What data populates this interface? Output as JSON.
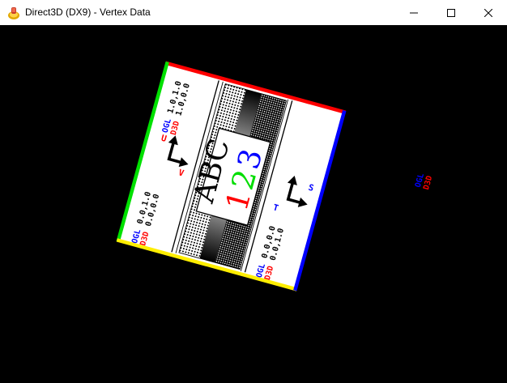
{
  "window": {
    "title": "Direct3D (DX9) - Vertex Data",
    "controls": {
      "minimize_icon": "minimize-icon",
      "maximize_icon": "maximize-icon",
      "close_icon": "close-icon"
    }
  },
  "texture": {
    "center": {
      "letters": "ABC",
      "digit1": "1",
      "digit2": "2",
      "digit3": "3"
    },
    "left_top": {
      "ogl": "OGL",
      "ogl_val": "1.0,1.0",
      "d3d": "D3D",
      "d3d_val": "1.0,0.0"
    },
    "left_bottom": {
      "ogl": "OGL",
      "ogl_val": "0.0,1.0",
      "d3d": "D3D",
      "d3d_val": "0.0,0.0"
    },
    "right_top": {
      "ogl": "OGL",
      "ogl_val": "1.0,0.0",
      "d3d": "D3D",
      "d3d_val": "1.0,1.0"
    },
    "right_bottom": {
      "ogl": "OGL",
      "ogl_val": "0.0,0.0",
      "d3d": "D3D",
      "d3d_val": "0.0,1.0"
    },
    "axes_left": {
      "u": "U",
      "v": "V"
    },
    "axes_right": {
      "t": "T",
      "s": "S"
    },
    "edge_colors": {
      "top": "#ff0000",
      "left": "#00e000",
      "bottom": "#ffee00",
      "right": "#0000ff"
    },
    "label_colors": {
      "ogl": "#0000ff",
      "d3d": "#ff0000",
      "digit1": "#ff0000",
      "digit2": "#00dd00",
      "digit3": "#0000ff"
    }
  }
}
